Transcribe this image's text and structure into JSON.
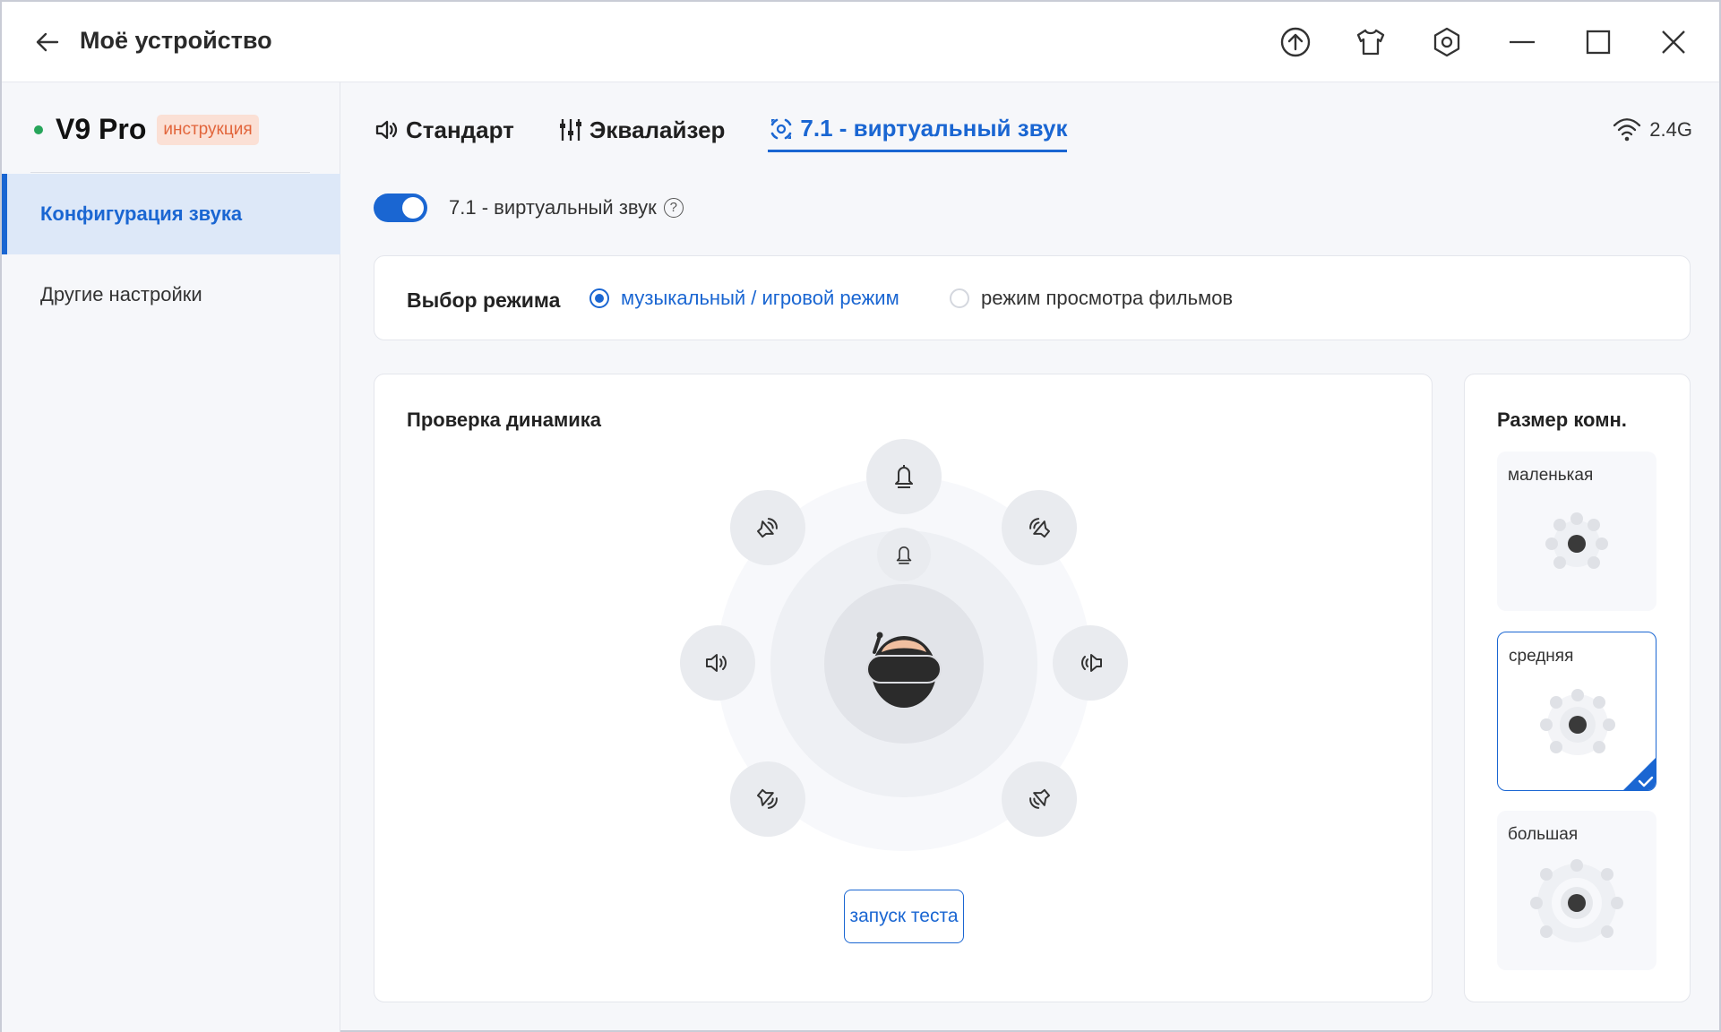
{
  "window": {
    "title": "Моё устройство",
    "icons": [
      "back-arrow-icon",
      "upload-icon",
      "shirt-icon",
      "settings-hex-icon",
      "minimize-icon",
      "maximize-icon",
      "close-icon"
    ]
  },
  "sidebar": {
    "device_name": "V9 Pro",
    "status_color": "#27a55a",
    "manual_badge": "инструкция",
    "items": [
      {
        "label": "Конфигурация звука",
        "active": true
      },
      {
        "label": "Другие настройки",
        "active": false
      }
    ]
  },
  "tabs": [
    {
      "label": "Стандарт",
      "icon": "speaker-icon",
      "active": false
    },
    {
      "label": "Эквалайзер",
      "icon": "equalizer-icon",
      "active": false
    },
    {
      "label": "7.1 - виртуальный звук",
      "icon": "surround-icon",
      "active": true
    }
  ],
  "connection": {
    "label": "2.4G",
    "icon": "wifi-icon"
  },
  "virtual_sound": {
    "label": "7.1 - виртуальный звук",
    "enabled": true,
    "help": "?"
  },
  "mode": {
    "title": "Выбор режима",
    "options": [
      {
        "label": "музыкальный / игровой режим",
        "selected": true
      },
      {
        "label": "режим просмотра фильмов",
        "selected": false
      }
    ]
  },
  "speaker_test": {
    "title": "Проверка динамика",
    "button": "запуск теста",
    "speakers": [
      "center",
      "front-left",
      "front-right",
      "side-left",
      "side-right",
      "rear-left",
      "rear-right",
      "subwoofer"
    ]
  },
  "room": {
    "title": "Размер комн.",
    "options": [
      {
        "label": "маленькая",
        "selected": false
      },
      {
        "label": "средняя",
        "selected": true
      },
      {
        "label": "большая",
        "selected": false
      }
    ]
  },
  "colors": {
    "accent": "#1a66d2",
    "badge_text": "#e2653b",
    "badge_bg": "#fbe0d5"
  }
}
